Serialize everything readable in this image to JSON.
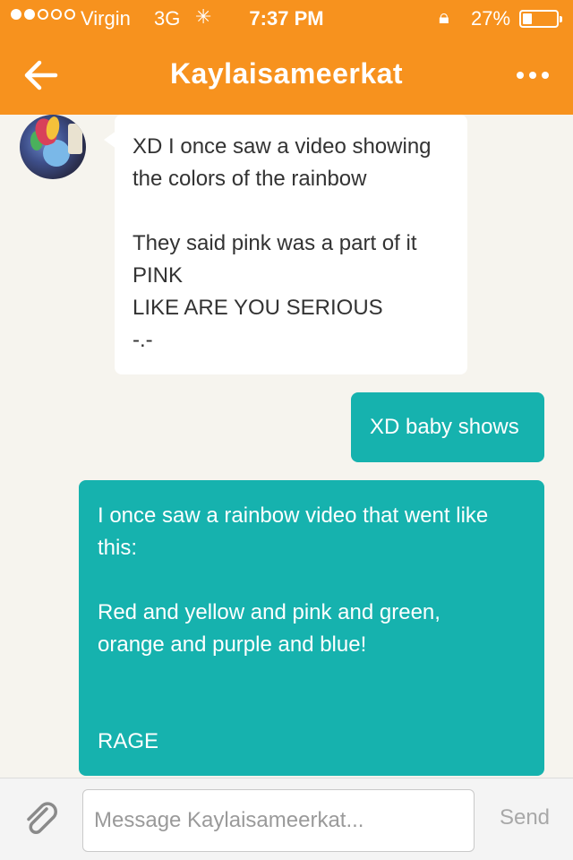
{
  "status_bar": {
    "signal_bars": 2,
    "signal_total": 5,
    "carrier": "Virgin",
    "network": "3G",
    "activity_icon": "loading-spinner-icon",
    "time": "7:37 PM",
    "orientation_lock_icon": "rotation-lock-icon",
    "battery_percent": "27%",
    "battery_level": 0.27
  },
  "nav": {
    "back_icon": "back-arrow-icon",
    "title": "Kaylaisameerkat",
    "more_icon": "more-options-icon"
  },
  "colors": {
    "brand": "#f7921e",
    "outgoing_bubble": "#16b2ae",
    "incoming_bubble": "#ffffff",
    "background": "#f6f4ee"
  },
  "messages": [
    {
      "direction": "incoming",
      "text": "XD I once saw a video showing\nthe colors of the rainbow\n\nThey said pink was a part of it\nPINK\nLIKE ARE YOU SERIOUS\n-.-"
    },
    {
      "direction": "outgoing",
      "text": "XD baby shows"
    },
    {
      "direction": "outgoing",
      "text": "I once saw a rainbow video that went like\nthis:\n\nRed and yellow and pink and green,\norange and purple and blue!\n\n\nRAGE"
    }
  ],
  "composer": {
    "attach_icon": "paperclip-icon",
    "placeholder": "Message Kaylaisameerkat...",
    "value": "",
    "send_label": "Send"
  }
}
